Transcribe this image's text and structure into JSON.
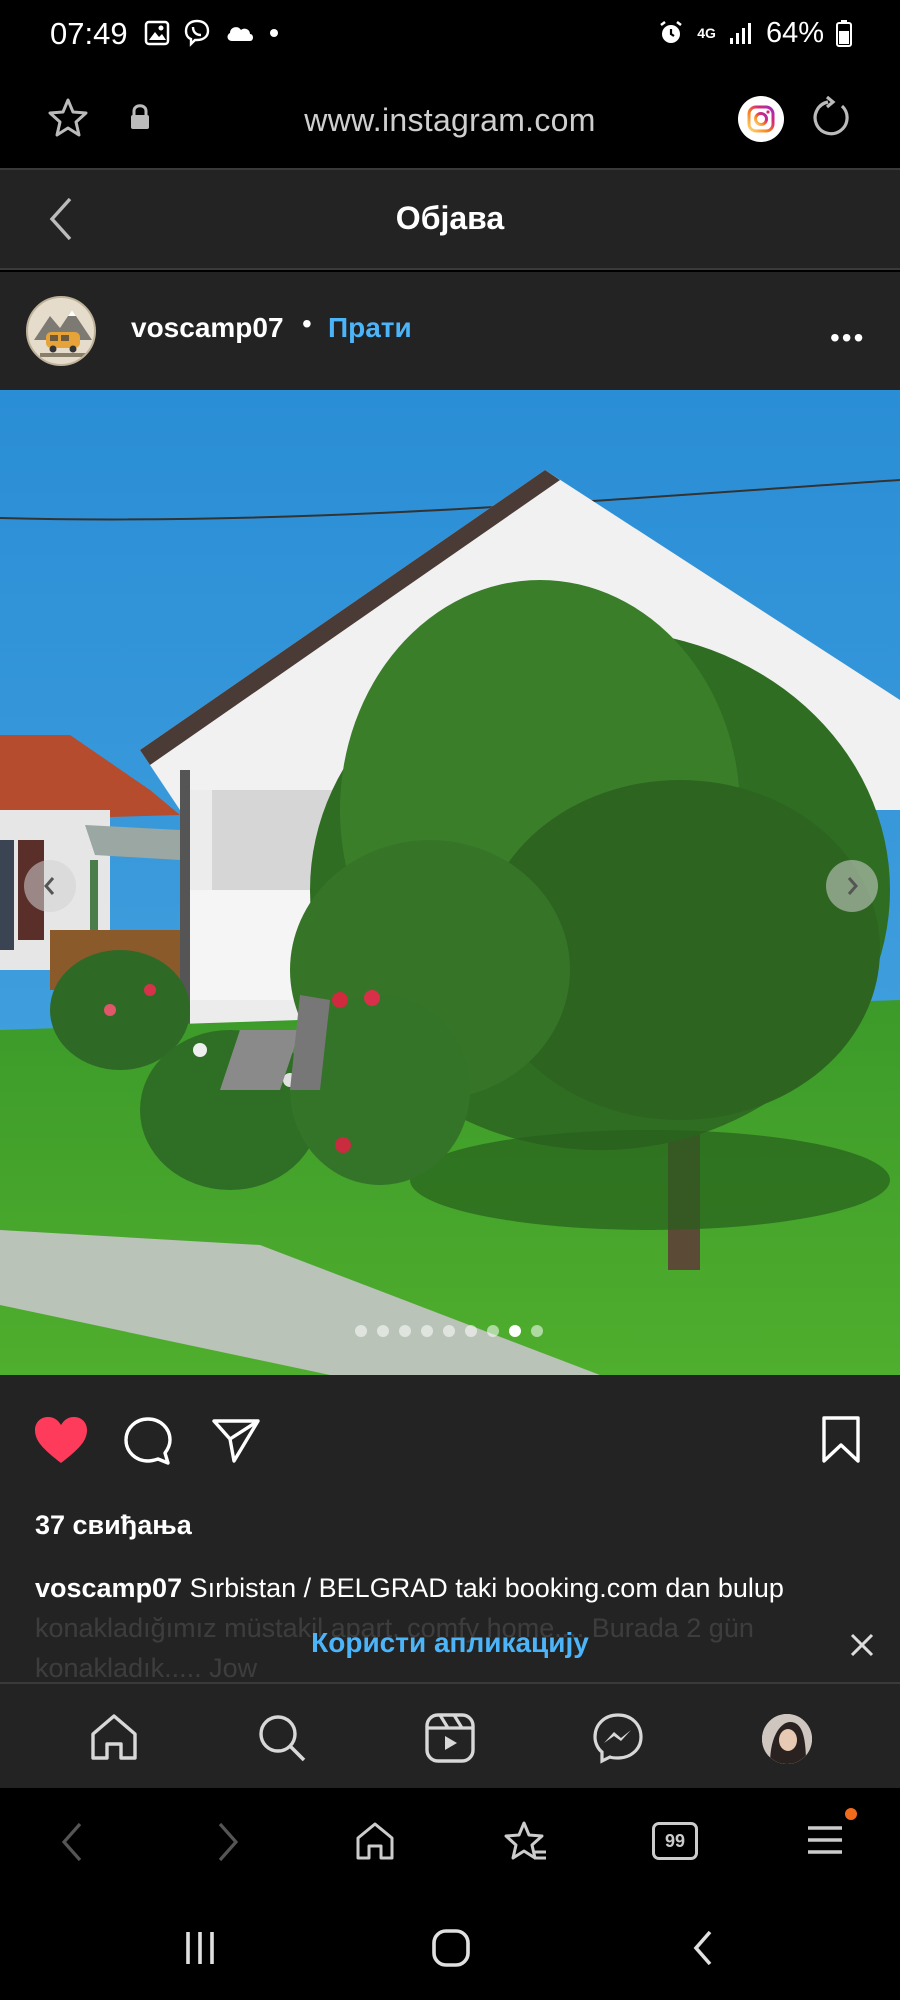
{
  "status_bar": {
    "time": "07:49",
    "battery": "64%",
    "network": "4G"
  },
  "browser": {
    "url": "www.instagram.com"
  },
  "header": {
    "title": "Објава"
  },
  "post": {
    "username": "voscamp07",
    "separator": "•",
    "follow_label": "Прати",
    "more_label": "•••",
    "likes": "37 свиђања",
    "caption_user": "voscamp07",
    "caption_text": "Sırbistan / BELGRAD taki booking.com dan bulup",
    "caption_faded": "konakladığımız müstakil apart, comfy home.... Burada 2 gün konakladık..... Jow"
  },
  "banner": {
    "use_app_label": "Користи апликацију"
  },
  "carousel": {
    "total": 9,
    "active_index": 7
  },
  "colors": {
    "accent": "#4cb5f9",
    "like": "#ff3b5c",
    "background": "#232323"
  },
  "icons": {
    "browser_bar": [
      "star-icon",
      "lock-icon",
      "instagram-icon",
      "reload-icon"
    ],
    "actions": [
      "heart-icon",
      "comment-icon",
      "share-icon",
      "bookmark-icon"
    ],
    "ig_nav": [
      "home-icon",
      "search-icon",
      "reels-icon",
      "messenger-icon",
      "profile-avatar"
    ],
    "browser_toolbar": [
      "back-icon",
      "forward-icon",
      "home-icon",
      "bookmarks-icon",
      "tabs-icon",
      "menu-icon"
    ],
    "system_nav": [
      "recents-icon",
      "home-icon",
      "back-icon"
    ]
  },
  "browser_toolbar": {
    "tabs_count": "99"
  }
}
